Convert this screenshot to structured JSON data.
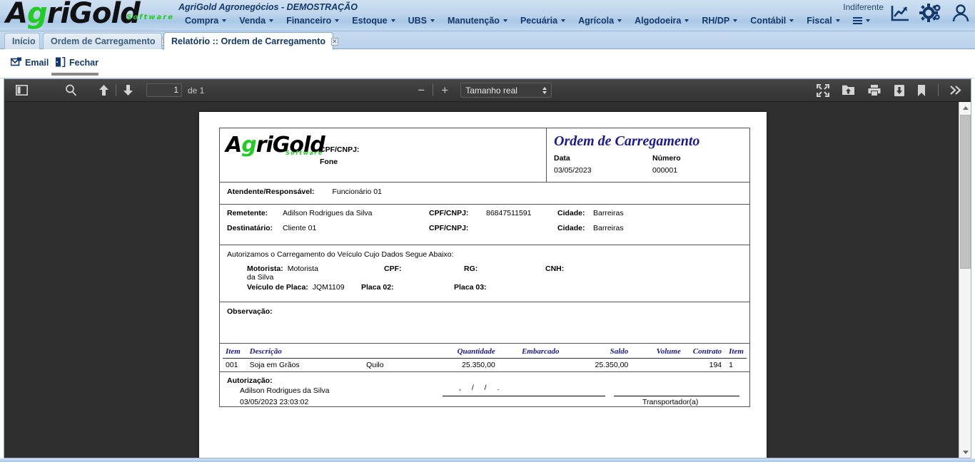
{
  "topbar": {
    "logo_text_a": "A",
    "logo_text_g": "g",
    "logo_text_rest": "riGold",
    "logo_sub": "Software",
    "app_title": "AgriGold Agronegócios - DEMOSTRAÇÃO",
    "status": "Indiferente",
    "menu": [
      {
        "label": "Compra",
        "caret": true
      },
      {
        "label": "Venda",
        "caret": true
      },
      {
        "label": "Financeiro",
        "caret": true
      },
      {
        "label": "Estoque",
        "caret": true
      },
      {
        "label": "UBS",
        "caret": true
      },
      {
        "label": "Manutenção",
        "caret": true
      },
      {
        "label": "Pecuária",
        "caret": true
      },
      {
        "label": "Agrícola",
        "caret": true
      },
      {
        "label": "Algodoeira",
        "caret": true
      },
      {
        "label": "RH/DP",
        "caret": true
      },
      {
        "label": "Contábil",
        "caret": true
      },
      {
        "label": "Fiscal",
        "caret": true
      }
    ],
    "icons": [
      "chart-icon",
      "gears-icon",
      "user-icon"
    ]
  },
  "tabs": [
    {
      "label": "Início",
      "active": false,
      "closable": false
    },
    {
      "label": "Ordem de Carregamento",
      "active": false,
      "closable": true
    },
    {
      "label": "Relatório :: Ordem de Carregamento",
      "active": true,
      "closable": true
    }
  ],
  "actionbar": {
    "email_label": "Email",
    "close_label": "Fechar"
  },
  "pdf_toolbar": {
    "sidebar_toggle": "sidebar-toggle-icon",
    "find": "search-icon",
    "prev_page": "arrow-up-icon",
    "next_page": "arrow-down-icon",
    "page_value": "1",
    "page_total_label": "de 1",
    "zoom_out": "−",
    "zoom_in": "+",
    "zoom_level": "Tamanho real",
    "presentation": "fullscreen-icon",
    "open": "open-folder-icon",
    "print": "print-icon",
    "download": "download-icon",
    "bookmark": "bookmark-icon",
    "more": "chevron-double-right-icon"
  },
  "document": {
    "company_logo_a": "A",
    "company_logo_g": "g",
    "company_logo_rest": "riGold",
    "company_logo_sub": "Software",
    "company_cpf_label": "CPF/CNPJ:",
    "company_fone_label": "Fone",
    "title": "Ordem de Carregamento",
    "date_label": "Data",
    "date_value": "03/05/2023",
    "number_label": "Número",
    "number_value": "000001",
    "attendant_label": "Atendente/Responsável:",
    "attendant_value": "Funcionário 01",
    "sender_label": "Remetente:",
    "sender_value": "Adilson Rodrigues da Silva",
    "sender_cpf_label": "CPF/CNPJ:",
    "sender_cpf_value": "86847511591",
    "sender_city_label": "Cidade:",
    "sender_city_value": "Barreiras",
    "recipient_label": "Destinatário:",
    "recipient_value": "Cliente 01",
    "recipient_cpf_label": "CPF/CNPJ:",
    "recipient_cpf_value": "",
    "recipient_city_label": "Cidade:",
    "recipient_city_value": "Barreiras",
    "auth_vehicle_text": "Autorizamos o Carregamento do Veículo Cujo Dados Segue Abaixo:",
    "driver_label": "Motorista:",
    "driver_value": "Motorista da Silva",
    "driver_cpf_label": "CPF:",
    "driver_cpf_value": "",
    "driver_rg_label": "RG:",
    "driver_rg_value": "",
    "driver_cnh_label": "CNH:",
    "driver_cnh_value": "",
    "plate1_label": "Veículo de Placa:",
    "plate1_value": "JQM1109",
    "plate2_label": "Placa 02:",
    "plate2_value": "",
    "plate3_label": "Placa 03:",
    "plate3_value": "",
    "observation_label": "Observação:",
    "observation_value": "",
    "table": {
      "headers": [
        "Item",
        "Descrição",
        "",
        "Quantidade",
        "Embarcado",
        "Saldo",
        "Volume",
        "Contrato",
        "Item"
      ],
      "rows": [
        {
          "item": "001",
          "description": "Soja em Grãos",
          "unit": "Quilo",
          "quantity": "25.350,00",
          "shipped": "",
          "balance": "25.350,00",
          "volume": "",
          "contract": "194",
          "contract_item": "1"
        }
      ]
    },
    "authorization_label": "Autorização:",
    "authorization_name": "Adilson Rodrigues da Silva",
    "authorization_datetime": "03/05/2023 23:03:02",
    "signature_date_mask": ",    /    /    .",
    "transporter_caption": "Transportador(a)"
  },
  "colors": {
    "brand_blue": "#13386b",
    "brand_green": "#22cc22",
    "doc_title_blue": "#1b1b8f",
    "toolbar_dark": "#3b3b3b",
    "canvas_dark": "#2f2f2f"
  }
}
